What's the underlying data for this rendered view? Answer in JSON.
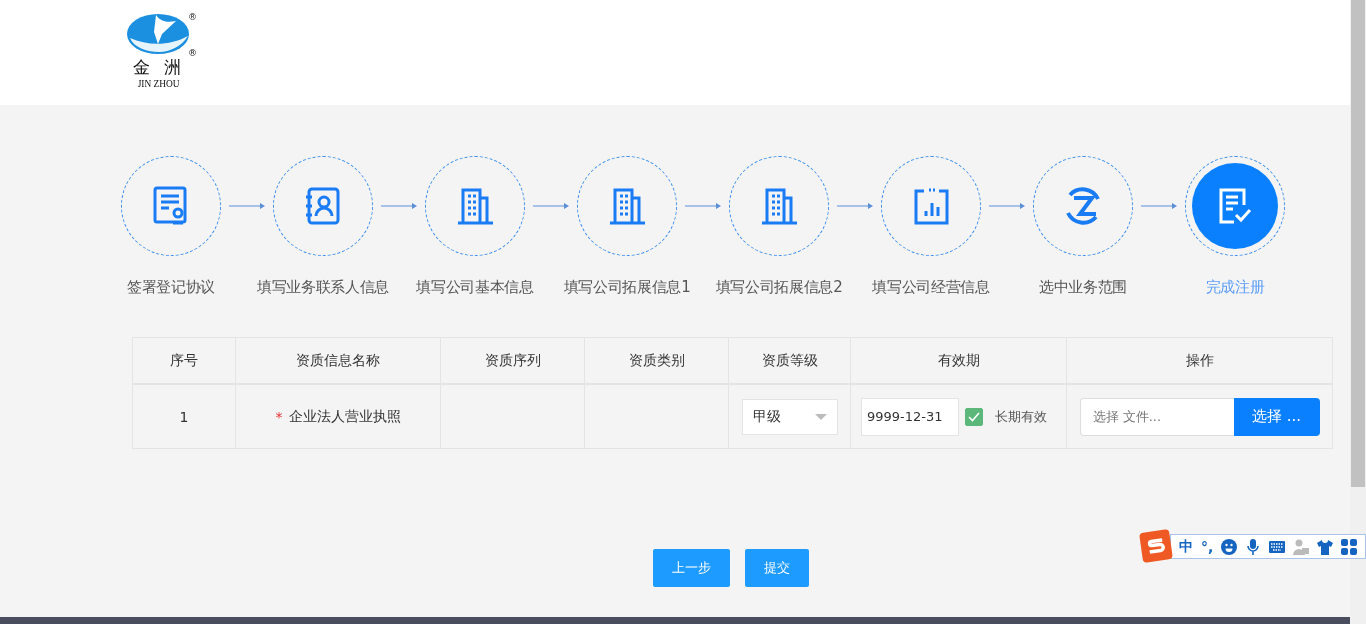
{
  "header": {
    "logo": {
      "name": "金 洲",
      "latin": "JIN ZHOU",
      "mark": "®"
    }
  },
  "steps": [
    {
      "label": "签署登记协议",
      "selected": false
    },
    {
      "label": "填写业务联系人信息",
      "selected": false
    },
    {
      "label": "填写公司基本信息",
      "selected": false
    },
    {
      "label": "填写公司拓展信息1",
      "selected": false
    },
    {
      "label": "填写公司拓展信息2",
      "selected": false
    },
    {
      "label": "填写公司经营信息",
      "selected": false
    },
    {
      "label": "选中业务范围",
      "selected": false
    },
    {
      "label": "完成注册",
      "selected": true
    }
  ],
  "table": {
    "columns": [
      "序号",
      "资质信息名称",
      "资质序列",
      "资质类别",
      "资质等级",
      "有效期",
      "操作"
    ],
    "rows": [
      {
        "index": "1",
        "required_mark": "*",
        "name": "企业法人营业执照",
        "level": "甲级",
        "expiry": "9999-12-31",
        "long_term_label": "长期有效",
        "long_term": true,
        "file_placeholder": "选择 文件...",
        "browse": "选择 ..."
      }
    ]
  },
  "buttons": [
    {
      "label": "上一步"
    },
    {
      "label": "提交"
    }
  ],
  "ime_toolbar": [
    {
      "kind": "logo"
    },
    {
      "kind": "text",
      "text": "中"
    },
    {
      "kind": "text",
      "text": "°,"
    },
    {
      "kind": "smile"
    },
    {
      "kind": "mic"
    },
    {
      "kind": "keyboard"
    },
    {
      "kind": "user"
    },
    {
      "kind": "shirt"
    },
    {
      "kind": "grid"
    }
  ]
}
